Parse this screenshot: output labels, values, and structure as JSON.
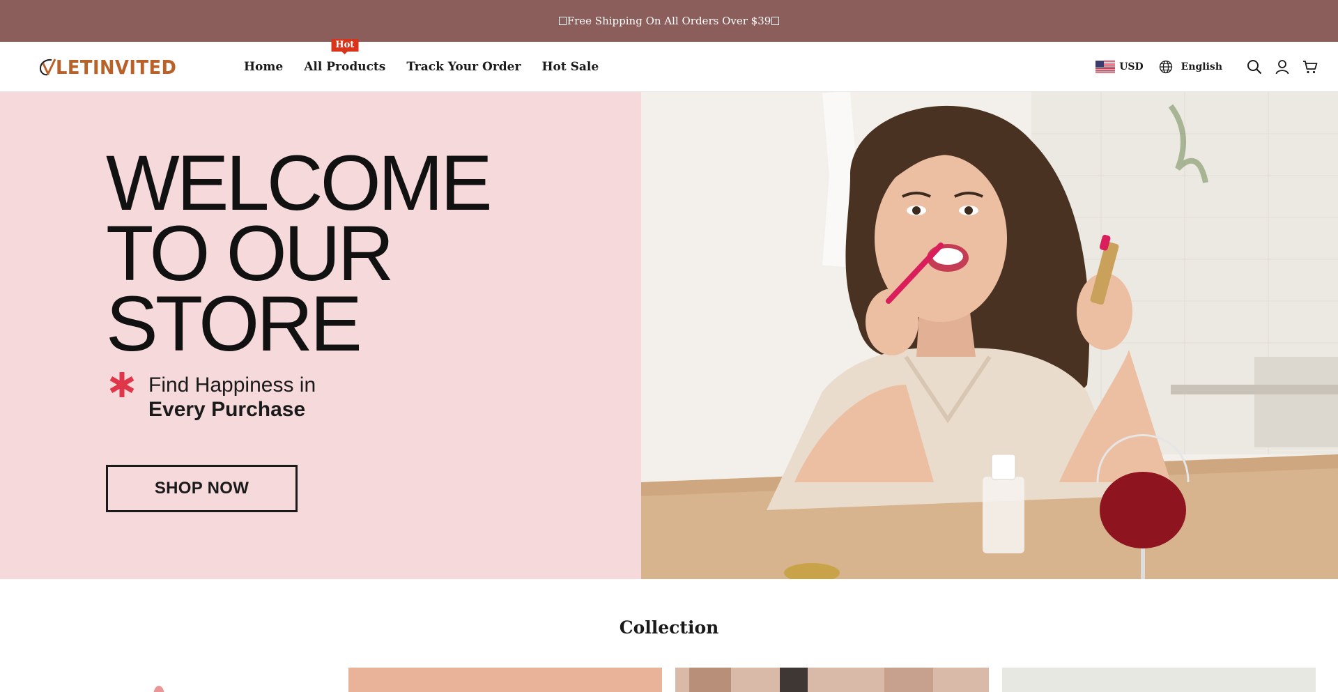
{
  "announcement": {
    "text": "Free Shipping On All Orders Over $39"
  },
  "header": {
    "logo_text": "LETINVITED",
    "nav": [
      {
        "label": "Home",
        "badge": ""
      },
      {
        "label": "All Products",
        "badge": "Hot"
      },
      {
        "label": "Track Your Order",
        "badge": ""
      },
      {
        "label": "Hot Sale",
        "badge": ""
      }
    ],
    "currency": "USD",
    "language": "English",
    "icons": [
      "search-icon",
      "account-icon",
      "cart-icon"
    ]
  },
  "hero": {
    "title_lines": [
      "WELCOME",
      "TO OUR",
      "STORE"
    ],
    "tagline_line1": "Find Happiness in",
    "tagline_line2": "Every Purchase",
    "button_label": "SHOP NOW",
    "accent_color": "#e0364a",
    "background_color": "#f5d9db"
  },
  "collection": {
    "title": "Collection"
  },
  "colors": {
    "announcement_bg": "#8b5e5b",
    "logo": "#b8622a",
    "hot_badge": "#d9331a"
  }
}
